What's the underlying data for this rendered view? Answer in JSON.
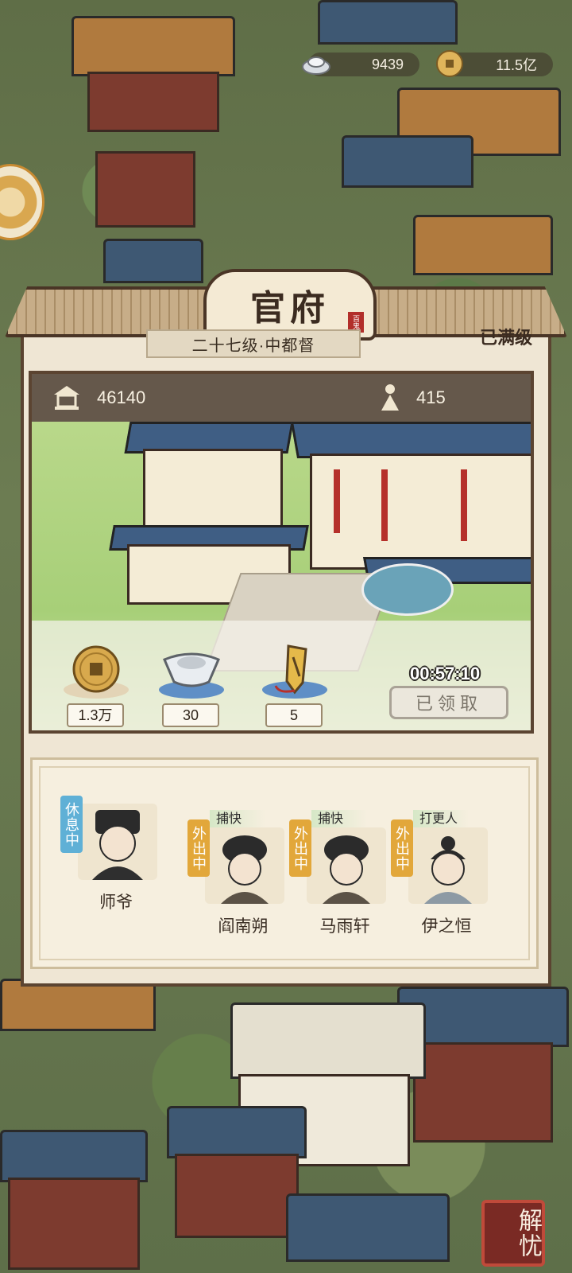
{
  "currencies": {
    "silver": {
      "value": "9439",
      "icon": "silver-ingot-icon"
    },
    "coin": {
      "value": "11.5亿",
      "icon": "copper-coin-icon"
    }
  },
  "panel": {
    "title": "官府",
    "seal": "百鬼",
    "rank": "二十七级·中都督",
    "maxed": "已满级",
    "stats": {
      "population": "46140",
      "population_icon": "pavilion-icon",
      "military": "415",
      "military_icon": "soldier-icon"
    },
    "rewards": [
      {
        "icon": "copper-coin-icon",
        "value": "1.3万"
      },
      {
        "icon": "silver-ingot-icon",
        "value": "30"
      },
      {
        "icon": "token-order-icon",
        "value": "5"
      }
    ],
    "timer": "00:57:10",
    "claim_button": "已领取"
  },
  "staff": [
    {
      "name": "师爷",
      "status": "休息中",
      "role": ""
    },
    {
      "name": "阎南朔",
      "status": "外出中",
      "role": "捕快"
    },
    {
      "name": "马雨轩",
      "status": "外出中",
      "role": "捕快"
    },
    {
      "name": "伊之恒",
      "status": "外出中",
      "role": "打更人"
    }
  ],
  "stamp": "解忧",
  "colors": {
    "panel_border": "#5b4431",
    "status_rest": "#5fb0d6",
    "status_out": "#e2a73a",
    "roof_blue": "#3f5e84"
  }
}
